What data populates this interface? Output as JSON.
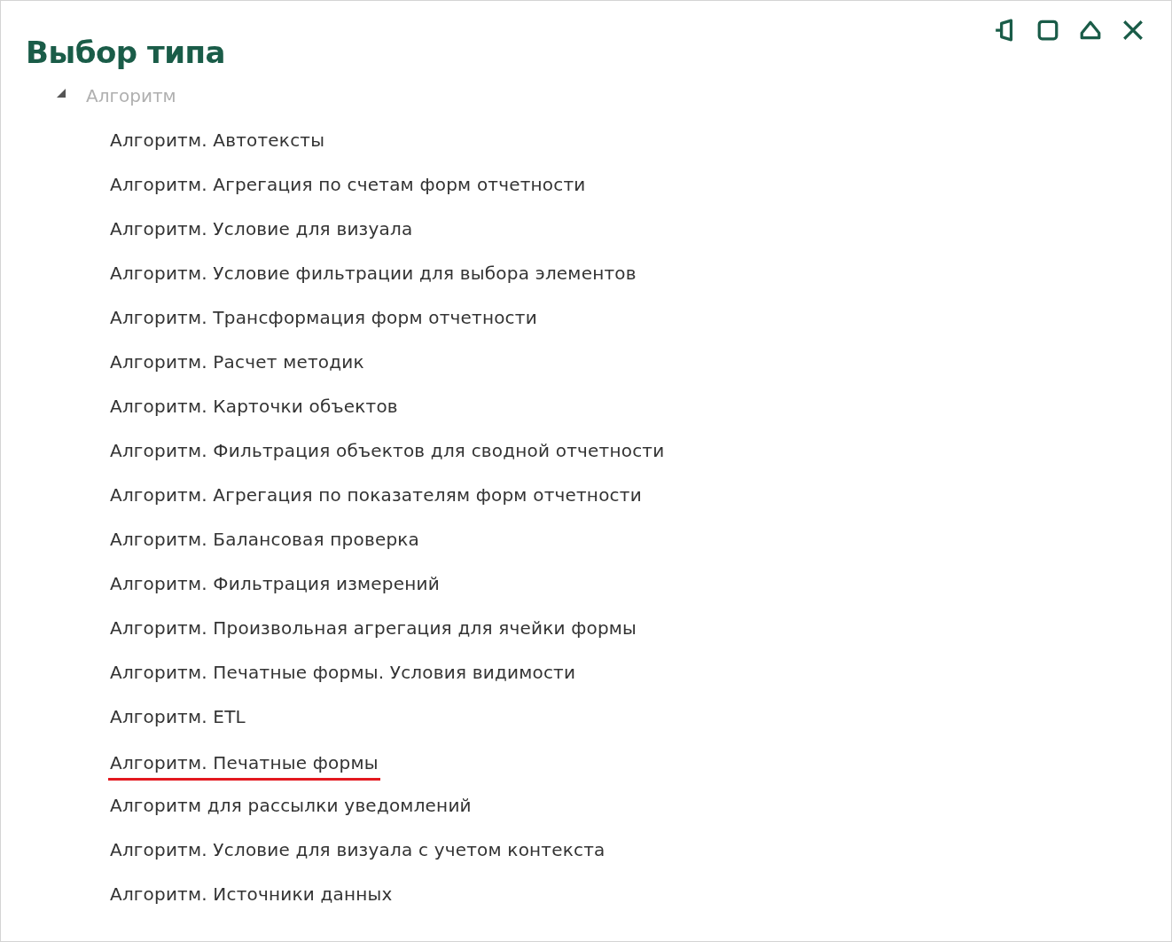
{
  "window": {
    "title": "Выбор типа"
  },
  "title_buttons": [
    {
      "kind": "pin"
    },
    {
      "kind": "maximize"
    },
    {
      "kind": "collapse"
    },
    {
      "kind": "close"
    }
  ],
  "tree": [
    {
      "label": "Алгоритм",
      "expanded": true,
      "disabled": true,
      "children": [
        {
          "label": "Алгоритм. Автотексты",
          "underlined": false
        },
        {
          "label": "Алгоритм. Агрегация по счетам форм отчетности",
          "underlined": false
        },
        {
          "label": "Алгоритм. Условие для визуала",
          "underlined": false
        },
        {
          "label": "Алгоритм. Условие фильтрации для выбора элементов",
          "underlined": false
        },
        {
          "label": "Алгоритм. Трансформация форм отчетности",
          "underlined": false
        },
        {
          "label": "Алгоритм. Расчет методик",
          "underlined": false
        },
        {
          "label": "Алгоритм. Карточки объектов",
          "underlined": false
        },
        {
          "label": "Алгоритм. Фильтрация объектов для сводной отчетности",
          "underlined": false
        },
        {
          "label": "Алгоритм. Агрегация по показателям форм отчетности",
          "underlined": false
        },
        {
          "label": "Алгоритм. Балансовая проверка",
          "underlined": false
        },
        {
          "label": "Алгоритм. Фильтрация измерений",
          "underlined": false
        },
        {
          "label": "Алгоритм. Произвольная агрегация для ячейки формы",
          "underlined": false
        },
        {
          "label": "Алгоритм. Печатные формы. Условия видимости",
          "underlined": false
        },
        {
          "label": "Алгоритм. ETL",
          "underlined": false
        },
        {
          "label": "Алгоритм. Печатные формы",
          "underlined": true
        },
        {
          "label": "Алгоритм для рассылки уведомлений",
          "underlined": false
        },
        {
          "label": "Алгоритм. Условие для визуала с учетом контекста",
          "underlined": false
        },
        {
          "label": "Алгоритм. Источники данных",
          "underlined": false
        }
      ]
    }
  ]
}
